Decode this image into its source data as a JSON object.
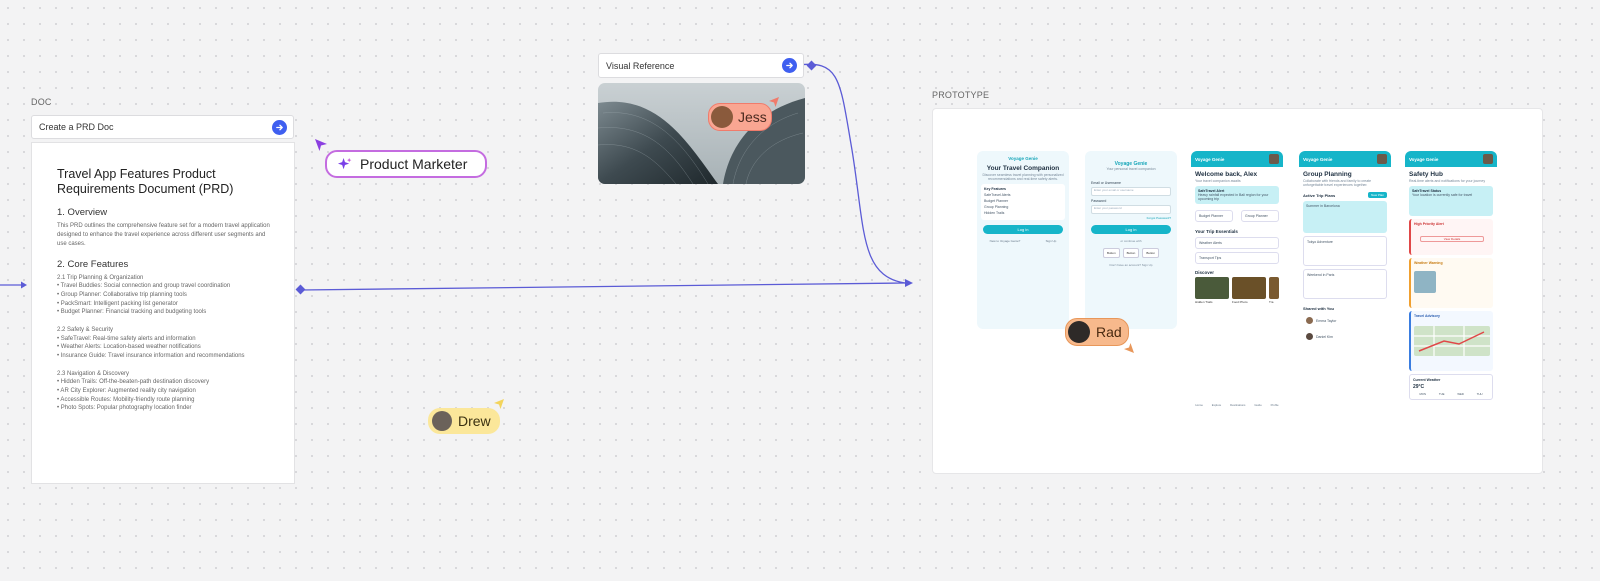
{
  "doc": {
    "section_label": "DOC",
    "prompt": "Create a PRD Doc",
    "title": "Travel App Features Product Requirements Document (PRD)",
    "overview_heading": "1. Overview",
    "overview_text": "This PRD outlines the comprehensive feature set for a modern travel application designed to enhance the travel experience across different user segments and use cases.",
    "core_heading": "2. Core Features",
    "groups": [
      {
        "title": "2.1 Trip Planning & Organization",
        "items": [
          "• Travel Buddies: Social connection and group travel coordination",
          "• Group Planner: Collaborative trip planning tools",
          "• PackSmart: Intelligent packing list generator",
          "• Budget Planner: Financial tracking and budgeting tools"
        ]
      },
      {
        "title": "2.2 Safety & Security",
        "items": [
          "• SafeTravel: Real-time safety alerts and information",
          "• Weather Alerts: Location-based weather notifications",
          "• Insurance Guide: Travel insurance information and recommendations"
        ]
      },
      {
        "title": "2.3 Navigation & Discovery",
        "items": [
          "• Hidden Trails: Off-the-beaten-path destination discovery",
          "• AR City Explorer: Augmented reality city navigation",
          "• Accessible Routes: Mobility-friendly route planning",
          "• Photo Spots: Popular photography location finder"
        ]
      }
    ]
  },
  "visual_reference": {
    "prompt": "Visual Reference"
  },
  "prototype": {
    "section_label": "PROTOTYPE",
    "screens": {
      "s1": {
        "brand": "Voyage Genie",
        "title": "Your Travel Companion",
        "sub": "Discover seamless travel planning with personalized recommendations and real-time safety alerts.",
        "features_title": "Key Features",
        "features": [
          "SafeTravel Alerts",
          "Budget Planner",
          "Group Planning",
          "Hidden Trails"
        ],
        "button": "Log in",
        "footer_left": "New to Voyage Genie?",
        "footer_right": "Sign Up"
      },
      "s2": {
        "brand": "Voyage Genie",
        "sub": "Your personal travel companion",
        "label_user": "Email or Username",
        "user_placeholder": "Enter your email or username",
        "label_pass": "Password",
        "pass_placeholder": "Enter your password",
        "forgot": "Forgot Password?",
        "button": "Log in",
        "or": "or continue with",
        "social": [
          "Button",
          "Button",
          "Button"
        ],
        "footer": "Don't have an account? Sign Up"
      },
      "s3": {
        "brand": "Voyage Genie",
        "title": "Welcome back, Alex",
        "sub": "Your travel companion awaits",
        "alert_title": "SafeTravel Alert",
        "alert_text": "Heavy rainfall expected in Bali region for your upcoming trip",
        "card1": "Budget Planner",
        "card2": "Group Planner",
        "essentials": "Your Trip Essentials",
        "ess1": "Weather Alerts",
        "ess2": "Transport Tips",
        "discover": "Discover",
        "disc": [
          "Hidden Trails",
          "Food Photo",
          "Tra"
        ],
        "nav": [
          "Home",
          "Explore",
          "Destinations",
          "Guide",
          "Profile"
        ]
      },
      "s4": {
        "brand": "Voyage Genie",
        "title": "Group Planning",
        "sub": "Collaborate with friends and family to create unforgettable travel experiences together.",
        "active": "Active Trip Plans",
        "new_btn": "New Plan",
        "trips": [
          "Summer in Barcelona",
          "Tokyo Adventure",
          "Weekend in Paris"
        ],
        "shared": "Shared with You",
        "people": [
          "Emma Taylor",
          "Daniel Kim"
        ]
      },
      "s5": {
        "brand": "Voyage Genie",
        "title": "Safety Hub",
        "sub": "Real-time alerts and notifications for your journey",
        "status_title": "SafeTravel Status",
        "status_text": "Your location is currently safe for travel",
        "alert1": "High Priority Alert",
        "alert1_btn": "View Details",
        "alert2": "Weather Warning",
        "alert3": "Travel Advisory",
        "weather_title": "Current Weather",
        "temp": "29°C",
        "days": [
          "MON",
          "TUE",
          "WED",
          "THU"
        ]
      }
    }
  },
  "cursors": {
    "product_marketer": "Product Marketer",
    "jess": "Jess",
    "rad": "Rad",
    "drew": "Drew"
  }
}
